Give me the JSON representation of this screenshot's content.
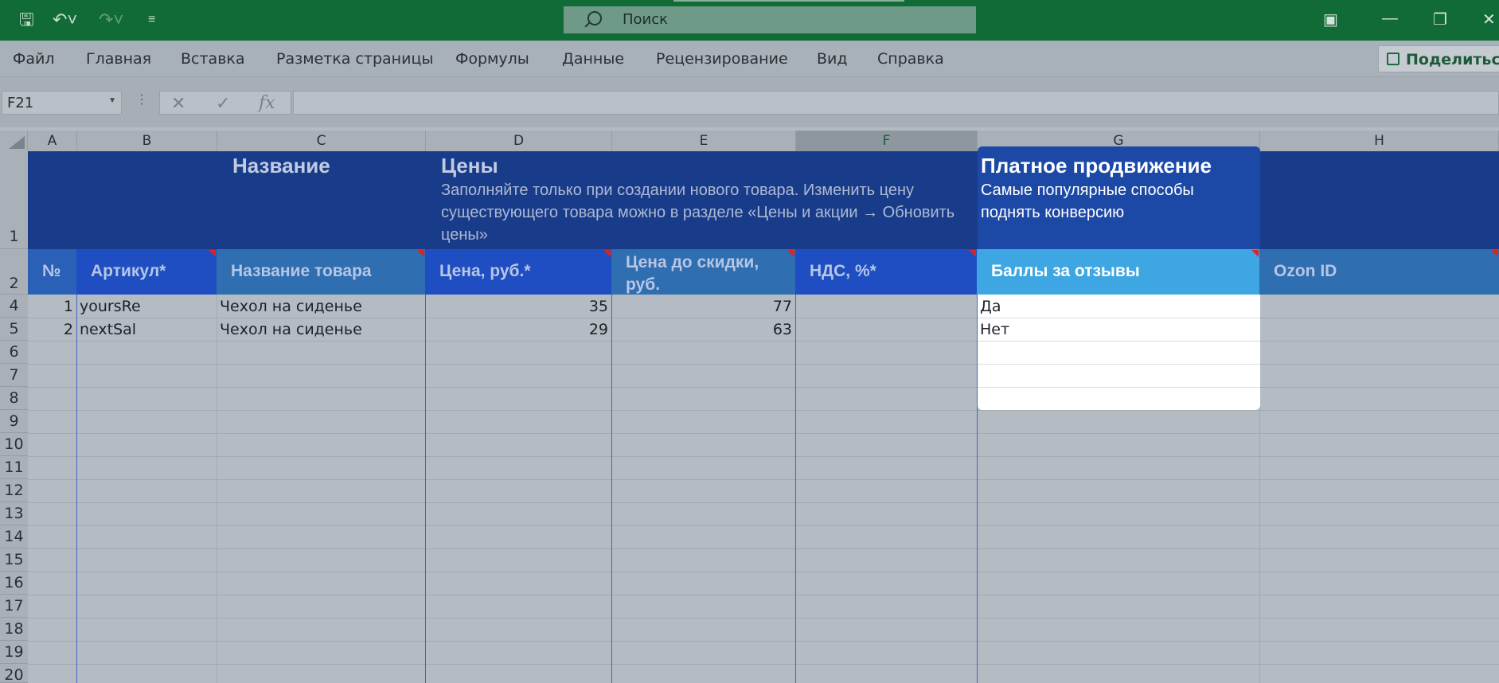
{
  "titlebar": {
    "search_placeholder": "Поиск"
  },
  "menu": {
    "items": [
      "Файл",
      "Главная",
      "Вставка",
      "Разметка страницы",
      "Формулы",
      "Данные",
      "Рецензирование",
      "Вид",
      "Справка"
    ],
    "share_label": "Поделиться"
  },
  "formula_bar": {
    "name_box": "F21",
    "fx_label": "fx",
    "formula": ""
  },
  "columns": [
    "A",
    "B",
    "C",
    "D",
    "E",
    "F",
    "G",
    "H"
  ],
  "selected_column": "F",
  "rows": [
    "1",
    "2",
    "4",
    "5",
    "6",
    "7",
    "8",
    "9",
    "10",
    "11",
    "12",
    "13",
    "14",
    "15",
    "16",
    "17",
    "18",
    "19",
    "20"
  ],
  "sheet": {
    "row1": {
      "name_title": "Название",
      "prices_title": "Цены",
      "prices_note": "Заполняйте только при создании нового товара. Изменить цену существующего товара можно в разделе «Цены и акции → Обновить цены»",
      "promo_title": "Платное продвижение",
      "promo_note": "Самые популярные способы поднять конверсию"
    },
    "headers": {
      "num": "№",
      "sku": "Артикул*",
      "product_name": "Название товара",
      "price": "Цена, руб.*",
      "price_before": "Цена до скидки, руб.",
      "vat": "НДС, %*",
      "review_points": "Баллы за отзывы",
      "ozon_id": "Ozon ID"
    },
    "data_rows": [
      {
        "num": "1",
        "sku": "yoursRe",
        "name": "Чехол на сиденье",
        "price": "35",
        "price_before": "77",
        "review_points": "Да"
      },
      {
        "num": "2",
        "sku": "nextSal",
        "name": "Чехол на сиденье",
        "price": "29",
        "price_before": "63",
        "review_points": "Нет"
      }
    ]
  }
}
